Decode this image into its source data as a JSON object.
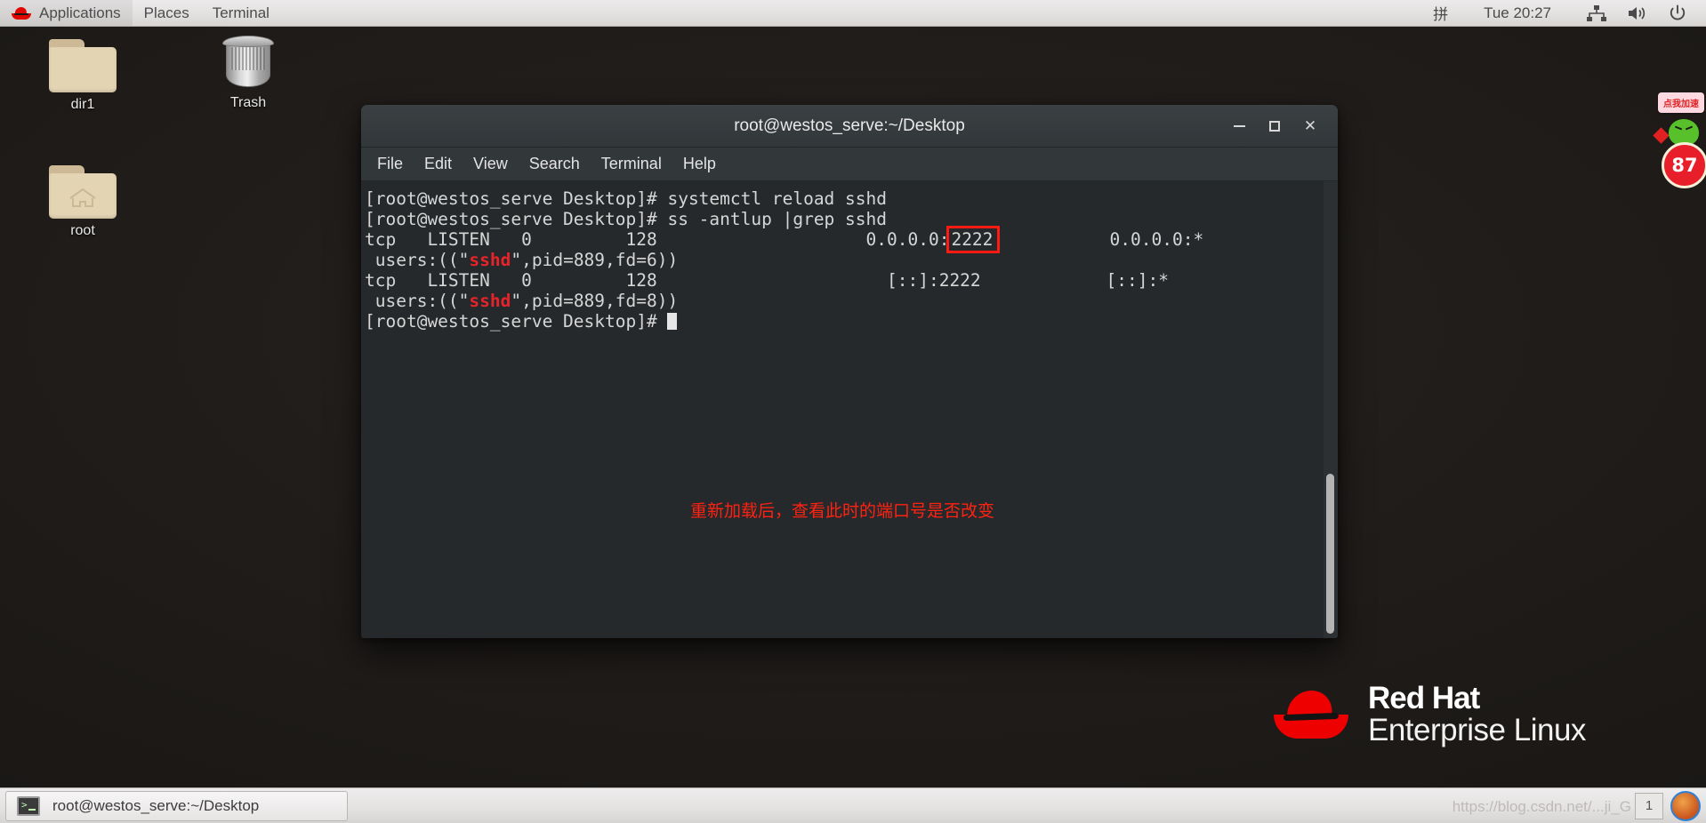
{
  "top_panel": {
    "logo_icon": "redhat-fedora-icon",
    "menus": [
      {
        "label": "Applications",
        "name": "applications-menu"
      },
      {
        "label": "Places",
        "name": "places-menu"
      },
      {
        "label": "Terminal",
        "name": "terminal-menu"
      }
    ],
    "tray": {
      "ime": "拼",
      "clock": "Tue 20:27",
      "network_icon": "network-wired-icon",
      "volume_icon": "volume-icon",
      "power_icon": "power-icon"
    }
  },
  "desktop": {
    "icons": [
      {
        "label": "dir1",
        "type": "folder",
        "name": "desktop-icon-dir1"
      },
      {
        "label": "Trash",
        "type": "trash",
        "name": "desktop-icon-trash"
      },
      {
        "label": "root",
        "type": "home-folder",
        "name": "desktop-icon-root"
      }
    ],
    "brand": {
      "line1": "Red Hat",
      "line2": "Enterprise Linux",
      "hat_icon": "redhat-hat-icon"
    }
  },
  "terminal": {
    "title": "root@westos_serve:~/Desktop",
    "window_controls": {
      "minimize": "minimize-button",
      "maximize": "maximize-button",
      "close": "close-button"
    },
    "menu": [
      {
        "label": "File",
        "name": "term-menu-file"
      },
      {
        "label": "Edit",
        "name": "term-menu-edit"
      },
      {
        "label": "View",
        "name": "term-menu-view"
      },
      {
        "label": "Search",
        "name": "term-menu-search"
      },
      {
        "label": "Terminal",
        "name": "term-menu-terminal"
      },
      {
        "label": "Help",
        "name": "term-menu-help"
      }
    ],
    "lines": {
      "l1": "[root@westos_serve Desktop]# systemctl reload sshd",
      "l2": "[root@westos_serve Desktop]# ss -antlup |grep sshd",
      "l3_pre": "tcp   LISTEN   0         128                    0.0.0.0:",
      "l3_highlight": "2222",
      "l3_post": "           0.0.0.0:*",
      "l4_pre": " users:((\"",
      "l4_red": "sshd",
      "l4_post": "\",pid=889,fd=6))",
      "l5": "tcp   LISTEN   0         128                      [::]:2222            [::]:*",
      "l6_pre": " users:((\"",
      "l6_red": "sshd",
      "l6_post": "\",pid=889,fd=8))",
      "l7": "[root@westos_serve Desktop]# "
    },
    "annotation": "重新加载后，查看此时的端口号是否改变",
    "highlight_color": "#ff1b11",
    "scrollbar": "terminal-scrollbar"
  },
  "ad_widget": {
    "bubble": "点我加速",
    "score": "87"
  },
  "taskbar": {
    "task_label": "root@westos_serve:~/Desktop",
    "task_icon": "terminal-icon",
    "watermark": "https://blog.csdn.net/...ji_G",
    "workspace": "1"
  }
}
